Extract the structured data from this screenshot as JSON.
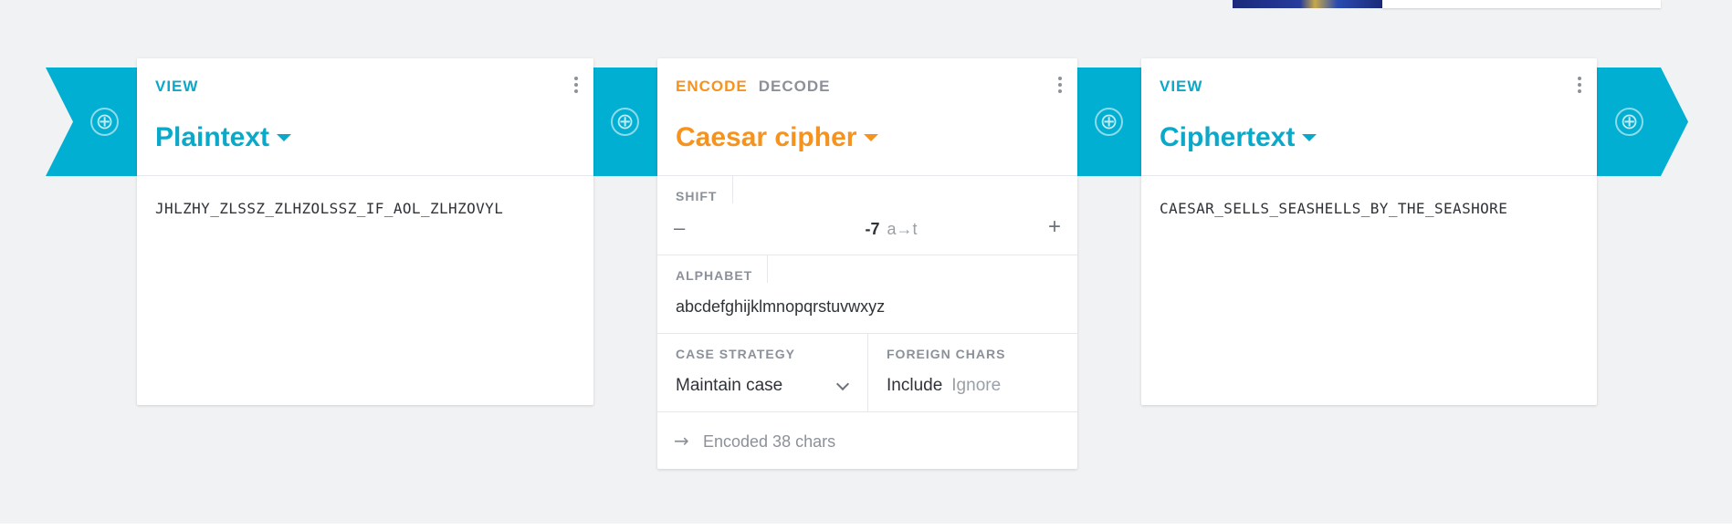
{
  "pipeline": {
    "add_glyph": "⊕"
  },
  "left_card": {
    "tab": "VIEW",
    "title": "Plaintext",
    "content": "JHLZHY_ZLSSZ_ZLHZOLSSZ_IF_AOL_ZLHZOVYL"
  },
  "middle_card": {
    "tabs": {
      "encode": "ENCODE",
      "decode": "DECODE"
    },
    "active_tab": "ENCODE",
    "title": "Caesar cipher",
    "shift": {
      "label": "SHIFT",
      "minus": "–",
      "value": "-7",
      "mapping": "a→t",
      "plus": "+"
    },
    "alphabet": {
      "label": "ALPHABET",
      "value": "abcdefghijklmnopqrstuvwxyz"
    },
    "case_strategy": {
      "label": "CASE STRATEGY",
      "value": "Maintain case"
    },
    "foreign_chars": {
      "label": "FOREIGN CHARS",
      "options": [
        "Include",
        "Ignore"
      ],
      "selected": "Include"
    },
    "status": {
      "arrow": "→",
      "text": "Encoded 38 chars"
    }
  },
  "right_card": {
    "tab": "VIEW",
    "title": "Ciphertext",
    "content": "CAESAR_SELLS_SEASHELLS_BY_THE_SEASHORE"
  },
  "colors": {
    "accent_blue": "#00afd2",
    "accent_orange": "#f6921e",
    "background": "#f1f2f4"
  }
}
